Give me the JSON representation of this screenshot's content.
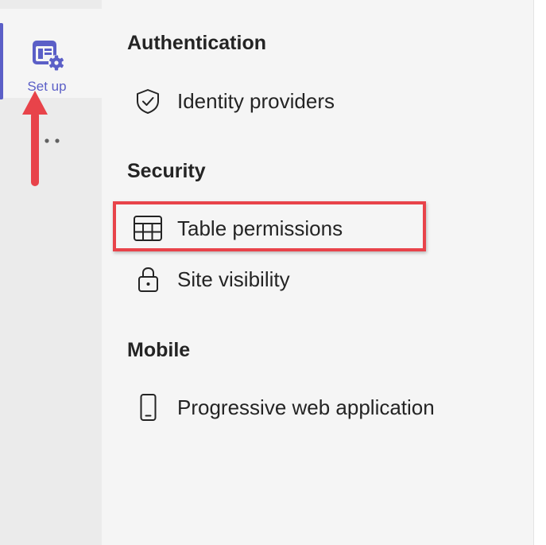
{
  "rail": {
    "setup_label": "Set up",
    "setup_icon": "settings-app-icon",
    "more_icon": "more-dots-icon",
    "accent_color": "#5b5fc7"
  },
  "sections": [
    {
      "heading": "Authentication",
      "items": [
        {
          "label": "Identity providers",
          "icon": "shield-check-icon"
        }
      ]
    },
    {
      "heading": "Security",
      "items": [
        {
          "label": "Table permissions",
          "icon": "table-icon"
        },
        {
          "label": "Site visibility",
          "icon": "lock-icon"
        }
      ]
    },
    {
      "heading": "Mobile",
      "items": [
        {
          "label": "Progressive web application",
          "icon": "phone-icon"
        }
      ]
    }
  ],
  "annotations": {
    "highlight_color": "#e8434a",
    "arrow_color": "#e8434a"
  }
}
